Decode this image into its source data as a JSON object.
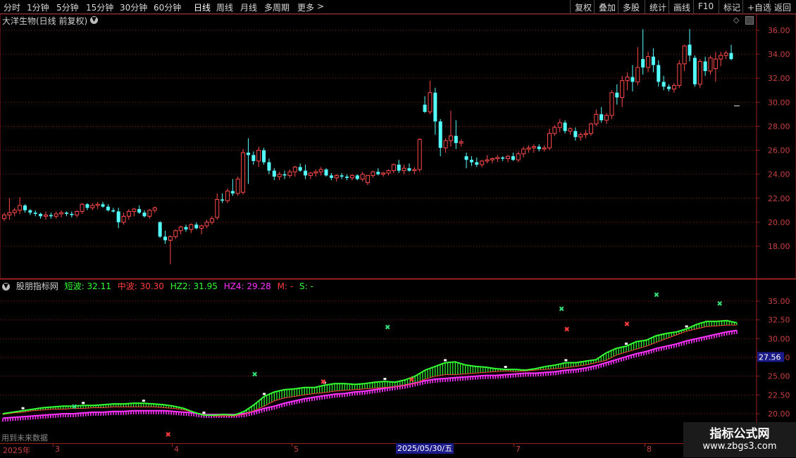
{
  "toolbar": {
    "periods": [
      "分时",
      "1分钟",
      "5分钟",
      "15分钟",
      "30分钟",
      "60分钟",
      "日线",
      "周线",
      "月线",
      "多周期",
      "更多"
    ],
    "more_arrow": ">",
    "right_buttons": [
      "复权",
      "叠加",
      "多股",
      "统计",
      "画线",
      "F10",
      "标记",
      "+自选",
      "返回"
    ]
  },
  "price_panel": {
    "title": "大洋生物(日线 前复权)",
    "y_ticks": [
      "36.00",
      "34.00",
      "32.00",
      "30.00",
      "28.00",
      "26.00",
      "24.00",
      "22.00",
      "20.00",
      "18.00"
    ]
  },
  "indicator_panel": {
    "name": "股朋指标网",
    "short_label": "短波: 32.11",
    "mid_label": "中波: 30.30",
    "hz2_label": "HZ2: 31.95",
    "hz4_label": "HZ4: 29.28",
    "m_label": "M: -",
    "s_label": "S: -",
    "y_ticks": [
      "35.00",
      "32.50",
      "30.00",
      "27.50",
      "25.00",
      "22.50",
      "20.00"
    ],
    "current_value": "27.56",
    "future_note": "用到未来数据"
  },
  "date_axis": {
    "labels": [
      "2025年",
      "3",
      "4",
      "5",
      "7",
      "8"
    ],
    "highlight": "2025/05/30/五"
  },
  "watermark": {
    "line1": "指标公式网",
    "line2": "www.zbgs3.com"
  },
  "chart_data": [
    {
      "type": "candlestick",
      "title": "大洋生物(日线 前复权)",
      "ylim": [
        16.5,
        36.8
      ],
      "colors": {
        "up": "#ff4a4a",
        "down": "#54ffff"
      },
      "ohlc": [
        [
          20.3,
          20.8,
          20.1,
          20.6
        ],
        [
          20.6,
          22.0,
          20.2,
          20.8
        ],
        [
          20.8,
          21.2,
          20.5,
          21.0
        ],
        [
          21.0,
          22.1,
          20.7,
          21.4
        ],
        [
          21.4,
          21.5,
          20.8,
          21.0
        ],
        [
          21.0,
          21.1,
          20.6,
          20.8
        ],
        [
          20.8,
          21.0,
          20.5,
          20.7
        ],
        [
          20.7,
          20.8,
          20.3,
          20.5
        ],
        [
          20.5,
          20.9,
          20.2,
          20.6
        ],
        [
          20.6,
          20.8,
          20.3,
          20.5
        ],
        [
          20.5,
          20.9,
          20.3,
          20.7
        ],
        [
          20.7,
          21.0,
          20.4,
          20.8
        ],
        [
          20.8,
          20.9,
          20.5,
          20.7
        ],
        [
          20.7,
          20.9,
          20.4,
          20.6
        ],
        [
          20.6,
          21.0,
          20.4,
          20.9
        ],
        [
          20.9,
          21.6,
          20.7,
          21.5
        ],
        [
          21.5,
          21.6,
          21.0,
          21.2
        ],
        [
          21.2,
          21.6,
          21.0,
          21.4
        ],
        [
          21.4,
          21.7,
          21.1,
          21.5
        ],
        [
          21.5,
          21.7,
          21.2,
          21.3
        ],
        [
          21.3,
          21.5,
          20.9,
          21.0
        ],
        [
          21.0,
          21.2,
          20.8,
          20.9
        ],
        [
          20.9,
          21.2,
          19.5,
          20.0
        ],
        [
          20.0,
          20.8,
          19.8,
          20.5
        ],
        [
          20.5,
          21.1,
          20.2,
          20.9
        ],
        [
          20.9,
          21.2,
          20.5,
          21.1
        ],
        [
          21.1,
          21.4,
          20.7,
          20.8
        ],
        [
          20.8,
          21.0,
          20.4,
          20.5
        ],
        [
          20.5,
          21.1,
          20.3,
          21.0
        ],
        [
          21.0,
          21.3,
          20.8,
          21.2
        ],
        [
          20.0,
          20.1,
          18.7,
          18.8
        ],
        [
          18.8,
          19.3,
          18.2,
          18.5
        ],
        [
          18.5,
          18.9,
          16.5,
          18.8
        ],
        [
          18.8,
          19.4,
          18.6,
          19.3
        ],
        [
          19.3,
          19.7,
          19.0,
          19.6
        ],
        [
          19.6,
          19.8,
          19.2,
          19.4
        ],
        [
          19.4,
          19.9,
          19.1,
          19.8
        ],
        [
          19.8,
          20.0,
          19.4,
          19.5
        ],
        [
          19.5,
          19.8,
          19.0,
          19.7
        ],
        [
          19.7,
          20.2,
          19.5,
          20.0
        ],
        [
          20.0,
          20.5,
          19.8,
          20.3
        ],
        [
          20.4,
          22.4,
          20.2,
          21.9
        ],
        [
          21.9,
          22.4,
          21.6,
          21.8
        ],
        [
          21.8,
          22.8,
          21.6,
          22.6
        ],
        [
          22.6,
          23.6,
          22.2,
          22.4
        ],
        [
          22.4,
          23.8,
          22.2,
          23.6
        ],
        [
          22.5,
          26.1,
          22.3,
          25.8
        ],
        [
          25.8,
          27.0,
          23.2,
          25.6
        ],
        [
          25.6,
          25.9,
          24.8,
          25.1
        ],
        [
          25.1,
          26.3,
          24.6,
          26.0
        ],
        [
          26.0,
          26.2,
          24.8,
          25.0
        ],
        [
          25.0,
          25.3,
          24.0,
          24.3
        ],
        [
          24.3,
          24.5,
          23.5,
          23.8
        ],
        [
          23.8,
          24.2,
          23.5,
          24.0
        ],
        [
          24.0,
          24.3,
          23.6,
          23.9
        ],
        [
          23.9,
          24.4,
          23.7,
          24.2
        ],
        [
          24.2,
          24.7,
          23.8,
          24.6
        ],
        [
          24.6,
          24.9,
          24.2,
          24.3
        ],
        [
          24.3,
          24.8,
          23.6,
          23.9
        ],
        [
          23.9,
          24.2,
          23.6,
          24.1
        ],
        [
          24.1,
          24.4,
          23.8,
          24.2
        ],
        [
          24.2,
          24.6,
          23.9,
          24.4
        ],
        [
          24.4,
          24.5,
          23.8,
          23.9
        ],
        [
          23.9,
          24.1,
          23.5,
          23.7
        ],
        [
          23.7,
          24.0,
          23.4,
          23.9
        ],
        [
          23.9,
          24.1,
          23.6,
          23.8
        ],
        [
          23.8,
          24.0,
          23.5,
          23.7
        ],
        [
          23.7,
          24.0,
          23.5,
          23.9
        ],
        [
          23.9,
          24.0,
          23.5,
          23.6
        ],
        [
          23.6,
          24.2,
          23.4,
          24.0
        ],
        [
          23.3,
          23.9,
          23.1,
          23.9
        ],
        [
          23.9,
          24.3,
          23.7,
          24.2
        ],
        [
          24.2,
          24.5,
          23.9,
          24.0
        ],
        [
          24.0,
          24.2,
          23.8,
          24.1
        ],
        [
          24.1,
          24.4,
          23.9,
          24.3
        ],
        [
          24.3,
          24.9,
          24.1,
          24.8
        ],
        [
          24.8,
          25.2,
          24.1,
          24.3
        ],
        [
          24.3,
          24.8,
          24.0,
          24.5
        ],
        [
          24.5,
          24.9,
          24.2,
          24.3
        ],
        [
          24.3,
          24.6,
          24.0,
          24.4
        ],
        [
          24.4,
          27.0,
          24.2,
          26.9
        ],
        [
          29.8,
          30.5,
          29.1,
          29.2
        ],
        [
          29.2,
          31.8,
          29.0,
          30.8
        ],
        [
          30.8,
          31.2,
          27.3,
          28.4
        ],
        [
          28.4,
          28.6,
          25.5,
          26.2
        ],
        [
          26.2,
          27.0,
          25.8,
          26.8
        ],
        [
          26.8,
          29.3,
          26.3,
          27.2
        ],
        [
          27.2,
          28.5,
          26.1,
          26.6
        ],
        [
          26.6,
          26.9,
          26.3,
          26.7
        ],
        [
          25.5,
          25.8,
          24.5,
          25.2
        ],
        [
          25.2,
          25.5,
          24.7,
          25.0
        ],
        [
          25.0,
          25.4,
          24.6,
          24.8
        ],
        [
          24.8,
          25.2,
          24.6,
          25.1
        ],
        [
          25.1,
          25.6,
          24.9,
          25.2
        ],
        [
          25.2,
          25.4,
          24.9,
          25.3
        ],
        [
          25.3,
          25.6,
          25.0,
          25.4
        ],
        [
          25.4,
          25.5,
          25.1,
          25.3
        ],
        [
          25.3,
          25.6,
          25.0,
          25.5
        ],
        [
          25.5,
          25.8,
          25.1,
          25.2
        ],
        [
          25.2,
          25.9,
          25.0,
          25.7
        ],
        [
          25.7,
          26.3,
          25.4,
          26.1
        ],
        [
          26.1,
          26.4,
          25.8,
          26.2
        ],
        [
          26.2,
          26.5,
          25.8,
          26.3
        ],
        [
          26.3,
          26.5,
          25.9,
          26.1
        ],
        [
          26.1,
          26.4,
          25.9,
          26.2
        ],
        [
          26.2,
          27.8,
          26.0,
          27.4
        ],
        [
          27.4,
          28.1,
          27.2,
          27.9
        ],
        [
          27.9,
          28.6,
          27.5,
          28.3
        ],
        [
          28.3,
          28.5,
          27.4,
          27.6
        ],
        [
          27.6,
          27.9,
          27.3,
          27.8
        ],
        [
          27.6,
          27.9,
          26.8,
          27.1
        ],
        [
          27.1,
          27.5,
          26.8,
          27.3
        ],
        [
          27.3,
          27.7,
          27.0,
          27.4
        ],
        [
          27.4,
          28.3,
          27.2,
          28.2
        ],
        [
          28.2,
          29.4,
          28.0,
          29.0
        ],
        [
          29.0,
          29.6,
          28.3,
          28.5
        ],
        [
          28.5,
          29.1,
          28.2,
          28.9
        ],
        [
          28.9,
          31.0,
          28.6,
          30.8
        ],
        [
          30.8,
          31.5,
          29.8,
          30.4
        ],
        [
          30.4,
          32.2,
          29.6,
          31.8
        ],
        [
          31.8,
          32.5,
          31.0,
          32.1
        ],
        [
          32.1,
          33.1,
          30.9,
          31.7
        ],
        [
          31.7,
          34.6,
          31.4,
          32.9
        ],
        [
          33.6,
          36.1,
          32.3,
          32.9
        ],
        [
          32.9,
          34.2,
          32.5,
          33.8
        ],
        [
          33.8,
          34.5,
          32.5,
          33.1
        ],
        [
          33.1,
          33.5,
          31.3,
          31.7
        ],
        [
          31.7,
          32.2,
          31.0,
          31.3
        ],
        [
          31.3,
          31.5,
          30.9,
          31.1
        ],
        [
          31.1,
          31.6,
          30.8,
          31.4
        ],
        [
          31.4,
          33.5,
          31.2,
          33.2
        ],
        [
          33.2,
          34.8,
          32.6,
          34.7
        ],
        [
          34.8,
          36.1,
          33.4,
          33.9
        ],
        [
          33.7,
          33.9,
          31.3,
          31.5
        ],
        [
          31.5,
          33.6,
          31.2,
          33.4
        ],
        [
          33.4,
          33.8,
          32.2,
          32.6
        ],
        [
          32.6,
          33.9,
          32.3,
          33.7
        ],
        [
          32.8,
          34.2,
          31.7,
          33.6
        ],
        [
          33.6,
          34.2,
          33.0,
          33.9
        ],
        [
          33.9,
          34.3,
          33.6,
          34.1
        ],
        [
          34.1,
          34.8,
          33.5,
          33.6
        ]
      ]
    },
    {
      "type": "line",
      "title": "股朋指标网",
      "ylim": [
        19.0,
        37.0
      ],
      "series": [
        {
          "name": "短波",
          "color": "#33ff33",
          "values": [
            20.0,
            20.2,
            20.4,
            20.6,
            20.8,
            20.9,
            21.0,
            21.0,
            21.1,
            21.1,
            21.2,
            21.3,
            21.3,
            21.4,
            21.4,
            21.3,
            21.2,
            21.0,
            20.7,
            20.2,
            19.8,
            19.8,
            19.9,
            19.8,
            20.3,
            21.2,
            22.3,
            22.9,
            23.2,
            23.3,
            23.5,
            23.5,
            23.8,
            24.0,
            24.0,
            23.9,
            24.0,
            24.2,
            24.3,
            24.2,
            24.5,
            25.0,
            25.8,
            26.3,
            26.8,
            26.9,
            26.5,
            26.3,
            26.2,
            26.0,
            25.9,
            25.9,
            25.8,
            26.0,
            26.3,
            26.5,
            26.8,
            26.8,
            27.0,
            27.2,
            28.1,
            28.7,
            29.0,
            29.6,
            29.8,
            30.4,
            30.7,
            30.9,
            31.3,
            31.9,
            32.3,
            32.3,
            32.4,
            32.1
          ]
        },
        {
          "name": "中波",
          "color": "#ff3d3d",
          "values": [
            19.9,
            20.1,
            20.2,
            20.4,
            20.5,
            20.6,
            20.6,
            20.7,
            20.7,
            20.8,
            20.8,
            20.9,
            20.9,
            20.9,
            20.9,
            20.9,
            20.8,
            20.7,
            20.5,
            20.2,
            19.9,
            19.7,
            19.7,
            19.7,
            19.9,
            20.4,
            21.0,
            21.7,
            22.1,
            22.3,
            22.5,
            22.7,
            22.8,
            23.0,
            23.1,
            23.2,
            23.3,
            23.4,
            23.5,
            23.6,
            23.8,
            24.0,
            24.6,
            25.0,
            25.2,
            25.2,
            25.3,
            25.4,
            25.5,
            25.6,
            25.7,
            25.6,
            25.7,
            25.8,
            25.9,
            26.0,
            26.1,
            26.3,
            26.5,
            26.8,
            27.1,
            27.8,
            28.2,
            28.6,
            29.0,
            29.5,
            30.0,
            30.5,
            31.0,
            31.3,
            31.6,
            31.7,
            31.8,
            31.8
          ]
        },
        {
          "name": "HZ4",
          "color": "#ff33ff",
          "values": [
            19.4,
            19.5,
            19.6,
            19.7,
            19.8,
            19.9,
            20.0,
            20.0,
            20.1,
            20.2,
            20.2,
            20.3,
            20.3,
            20.4,
            20.4,
            20.4,
            20.4,
            20.3,
            20.2,
            20.1,
            19.9,
            19.9,
            19.9,
            19.9,
            20.0,
            20.3,
            20.7,
            21.0,
            21.4,
            21.7,
            22.0,
            22.2,
            22.4,
            22.6,
            22.7,
            22.9,
            23.0,
            23.2,
            23.4,
            23.6,
            23.8,
            24.1,
            24.4,
            24.6,
            24.7,
            24.8,
            24.9,
            25.0,
            25.1,
            25.1,
            25.2,
            25.3,
            25.4,
            25.4,
            25.5,
            25.6,
            25.8,
            25.9,
            26.1,
            26.4,
            26.8,
            27.2,
            27.6,
            28.0,
            28.3,
            28.7,
            29.0,
            29.3,
            29.7,
            30.0,
            30.3,
            30.6,
            30.9,
            31.1
          ]
        },
        {
          "name": "HZ2",
          "color": "#33ff33",
          "values": []
        }
      ],
      "signals": {
        "green_x": [
          [
            21,
            21.0
          ],
          [
            78,
            25.3
          ],
          [
            120,
            31.6
          ],
          [
            175,
            34.0
          ],
          [
            205,
            35.9
          ],
          [
            225,
            34.7
          ]
        ],
        "red_x": [
          [
            52,
            17.3
          ],
          [
            101,
            24.3
          ],
          [
            129,
            24.6
          ],
          [
            178,
            31.3
          ],
          [
            197,
            32.0
          ]
        ]
      }
    }
  ]
}
